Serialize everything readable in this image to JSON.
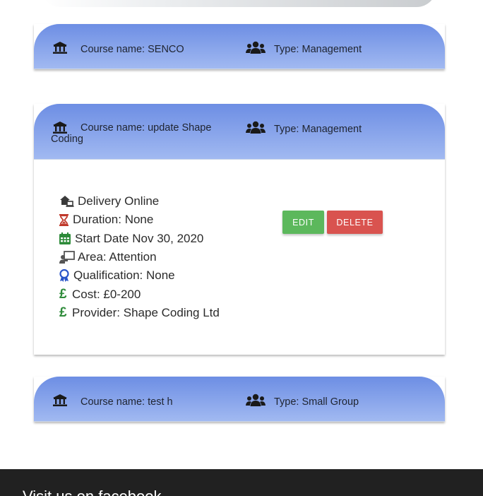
{
  "cards": [
    {
      "course_name": "Course name: SENCO",
      "type": "Type: Management"
    },
    {
      "course_name": "Course name: update Shape Coding",
      "type": "Type: Management",
      "details": {
        "delivery": "Delivery Online",
        "duration": "Duration: None",
        "start_date": "Start Date Nov 30, 2020",
        "area": "Area: Attention",
        "qualification": "Qualification: None",
        "cost": "Cost: £0-200",
        "provider": "Provider: Shape Coding Ltd"
      },
      "edit_label": "EDIT",
      "delete_label": "DELETE"
    },
    {
      "course_name": "Course name: test h",
      "type": "Type: Small Group"
    }
  ],
  "footer": {
    "text": "Visit us on facebook"
  },
  "colors": {
    "header_gradient_top": "#6d8ee4",
    "header_gradient_bottom": "#a1b9f1",
    "edit": "#5cb85c",
    "delete": "#d9534f",
    "footer_bg": "#212121"
  }
}
